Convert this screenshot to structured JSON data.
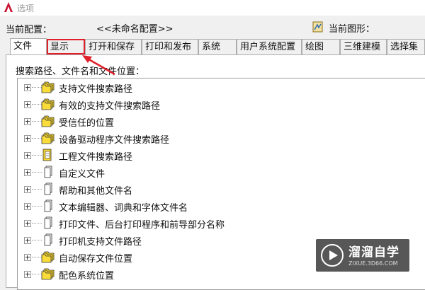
{
  "window": {
    "title": "选项"
  },
  "config": {
    "current_profile_label": "当前配置：",
    "current_profile_value": "<<未命名配置>>",
    "current_drawing_label": "当前图形："
  },
  "tabs": [
    {
      "label": "文件",
      "active": true
    },
    {
      "label": "显示",
      "highlighted": true
    },
    {
      "label": "打开和保存"
    },
    {
      "label": "打印和发布"
    },
    {
      "label": "系统"
    },
    {
      "label": "用户系统配置"
    },
    {
      "label": "绘图"
    },
    {
      "label": "三维建模"
    },
    {
      "label": "选择集"
    }
  ],
  "panel": {
    "search_label": "搜索路径、文件名和文件位置："
  },
  "tree": [
    {
      "label": "支持文件搜索路径",
      "icon": "folder-stack-icon"
    },
    {
      "label": "有效的支持文件搜索路径",
      "icon": "folder-stack-icon"
    },
    {
      "label": "受信任的位置",
      "icon": "folder-stack-icon"
    },
    {
      "label": "设备驱动程序文件搜索路径",
      "icon": "folder-stack-icon"
    },
    {
      "label": "工程文件搜索路径",
      "icon": "project-book-icon"
    },
    {
      "label": "自定义文件",
      "icon": "file-stack-icon"
    },
    {
      "label": "帮助和其他文件名",
      "icon": "file-stack-icon"
    },
    {
      "label": "文本编辑器、词典和字体文件名",
      "icon": "file-stack-icon"
    },
    {
      "label": "打印文件、后台打印程序和前导部分名称",
      "icon": "file-stack-icon"
    },
    {
      "label": "打印机支持文件路径",
      "icon": "file-stack-icon"
    },
    {
      "label": "自动保存文件位置",
      "icon": "folder-stack-icon"
    },
    {
      "label": "配色系统位置",
      "icon": "folder-stack-icon"
    }
  ],
  "colors": {
    "highlight": "#e0202a",
    "folder": "#f7d52a"
  },
  "watermark": {
    "text": "溜溜自学",
    "url": "ZIXUE.3D66.COM"
  }
}
